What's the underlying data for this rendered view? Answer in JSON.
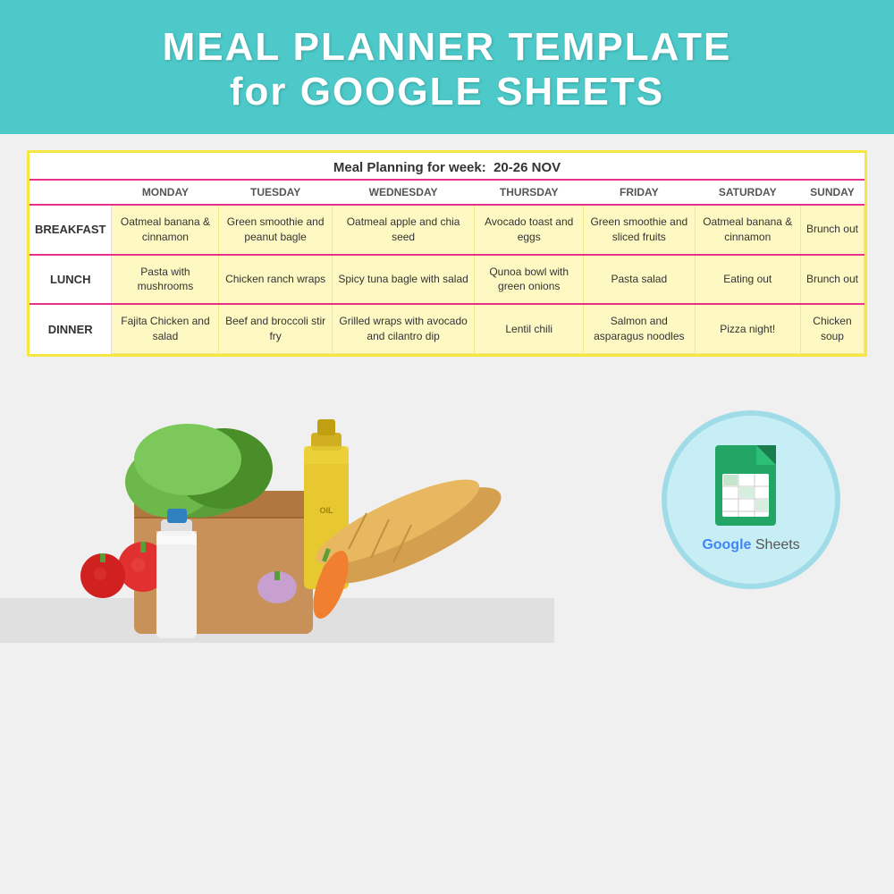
{
  "header": {
    "line1": "MEAL PLANNER TEMPLATE",
    "line2": "for GOOGLE SHEETS"
  },
  "table": {
    "week_label": "Meal Planning for week:",
    "week_range": "20-26 NOV",
    "days": [
      "MONDAY",
      "TUESDAY",
      "WEDNESDAY",
      "THURSDAY",
      "FRIDAY",
      "SATURDAY",
      "SUNDAY"
    ],
    "meals": [
      {
        "label": "BREAKFAST",
        "cells": [
          "Oatmeal banana & cinnamon",
          "Green smoothie and peanut bagle",
          "Oatmeal apple and chia seed",
          "Avocado toast and eggs",
          "Green smoothie and sliced fruits",
          "Oatmeal banana & cinnamon",
          "Brunch out"
        ]
      },
      {
        "label": "LUNCH",
        "cells": [
          "Pasta with mushrooms",
          "Chicken ranch wraps",
          "Spicy tuna bagle with salad",
          "Qunoa bowl with green onions",
          "Pasta salad",
          "Eating out",
          "Brunch out"
        ]
      },
      {
        "label": "DINNER",
        "cells": [
          "Fajita Chicken and salad",
          "Beef and broccoli stir fry",
          "Grilled wraps with avocado and cilantro dip",
          "Lentil chili",
          "Salmon and asparagus noodles",
          "Pizza night!",
          "Chicken soup"
        ]
      }
    ]
  },
  "google_sheets": {
    "label": "Google Sheets"
  }
}
